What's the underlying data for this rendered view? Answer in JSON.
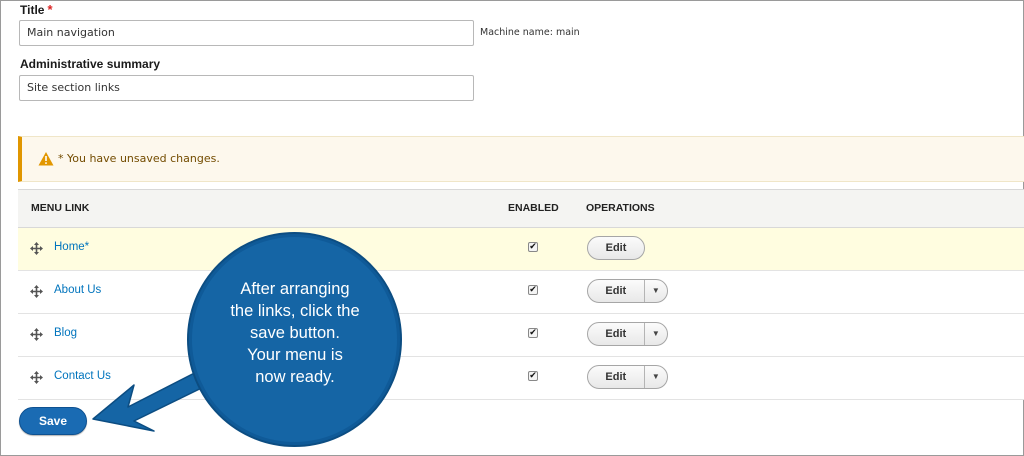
{
  "form": {
    "title_label": "Title",
    "required_mark": "*",
    "title_value": "Main navigation",
    "machine_name": "Machine name: main",
    "summary_label": "Administrative summary",
    "summary_value": "Site section links"
  },
  "warning": {
    "text": "* You have unsaved changes.",
    "icon": "warning-icon",
    "accent_color": "#e09600"
  },
  "table": {
    "headers": [
      "MENU LINK",
      "ENABLED",
      "OPERATIONS"
    ],
    "rows": [
      {
        "link": "Home*",
        "enabled": true,
        "operation": "Edit"
      },
      {
        "link": "About Us",
        "enabled": true,
        "operation": "Edit"
      },
      {
        "link": "Blog",
        "enabled": true,
        "operation": "Edit"
      },
      {
        "link": "Contact Us",
        "enabled": true,
        "operation": "Edit"
      }
    ],
    "checkmark": "✔",
    "caret": "▼"
  },
  "save_label": "Save",
  "callout": {
    "text_lines": [
      "After arranging",
      "the links, click the",
      "save button.",
      "Your menu is",
      "now ready."
    ],
    "color": "#1565a5"
  }
}
